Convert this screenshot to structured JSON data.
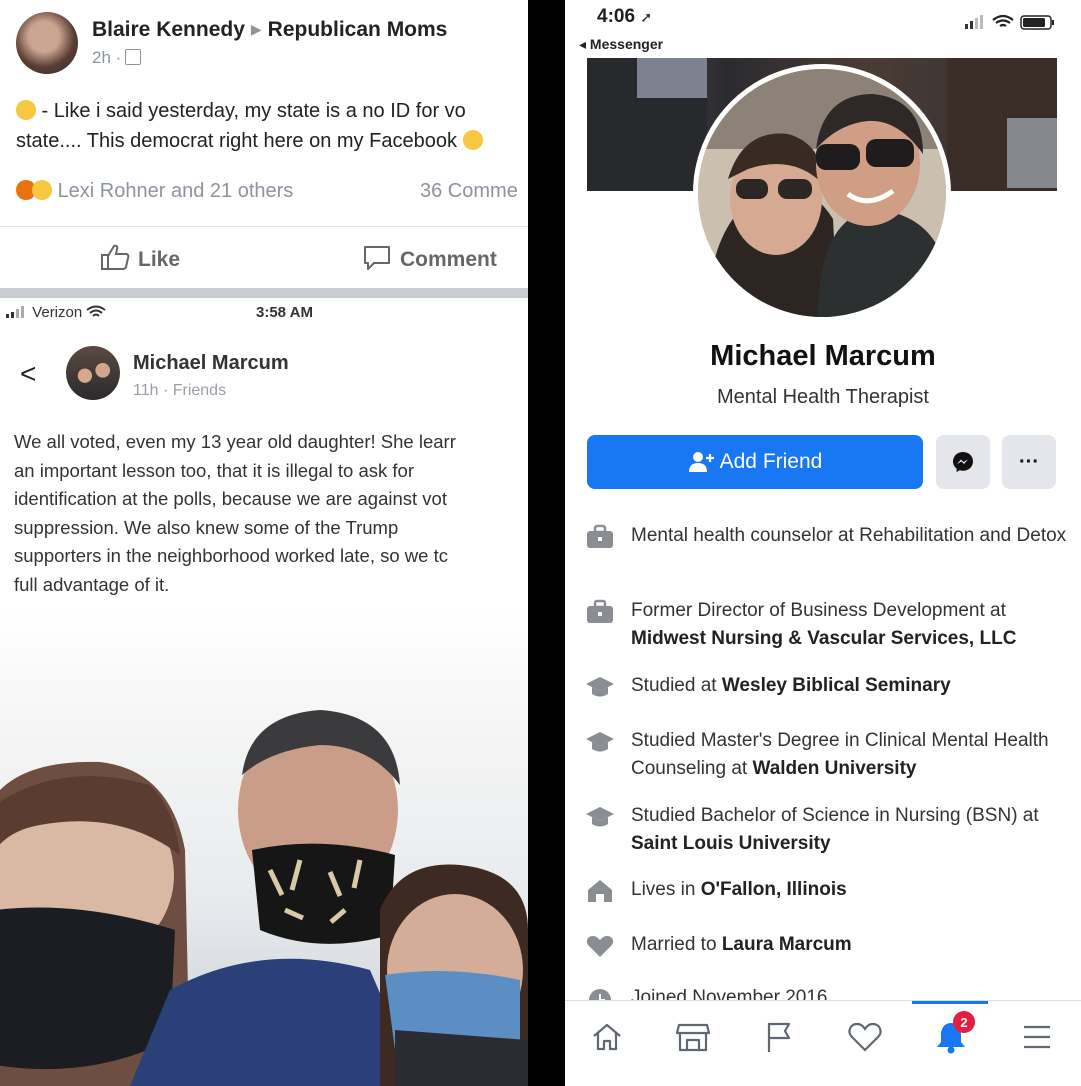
{
  "left_post": {
    "author": "Blaire Kennedy",
    "group": "Republican Moms",
    "time": "2h ·",
    "line1": " - Like i said yesterday, my state is a no ID for vo",
    "line2": "state.... This democrat right here on my Facebook",
    "reactions": "Lexi Rohner and 21 others",
    "comments": "36 Comme",
    "like_label": "Like",
    "comment_label": "Comment"
  },
  "shared_post": {
    "carrier": "Verizon",
    "time_of_day": "3:58 AM",
    "back": "<",
    "author": "Michael Marcum",
    "meta": "11h · Friends",
    "lines": [
      "We all voted, even my 13 year old daughter! She learr",
      "an important lesson too, that it is illegal to ask for",
      "identification at the polls, because we are against vot",
      "suppression. We also knew some of the Trump",
      "supporters in the neighborhood worked late, so we tc",
      "full advantage of it."
    ]
  },
  "profile": {
    "status_time": "4:06",
    "back_label": "◂ Messenger",
    "name": "Michael Marcum",
    "role": "Mental Health Therapist",
    "add_friend": "Add Friend",
    "more": "···",
    "info": [
      {
        "icon": "briefcase",
        "pre": "Mental health counselor at Rehabilitation and Detox",
        "bold": "",
        "post": ""
      },
      {
        "icon": "briefcase",
        "pre": "Former Director of Business Development at ",
        "bold": "Midwest Nursing & Vascular Services, LLC",
        "post": ""
      },
      {
        "icon": "graduation-cap",
        "pre": "Studied at ",
        "bold": "Wesley Biblical Seminary",
        "post": ""
      },
      {
        "icon": "graduation-cap",
        "pre": "Studied Master's Degree in Clinical Mental Health Counseling at ",
        "bold": "Walden University",
        "post": ""
      },
      {
        "icon": "graduation-cap",
        "pre": "Studied Bachelor of Science in Nursing (BSN) at ",
        "bold": "Saint Louis University",
        "post": ""
      },
      {
        "icon": "house",
        "pre": "Lives in ",
        "bold": "O'Fallon, Illinois",
        "post": ""
      },
      {
        "icon": "heart",
        "pre": "Married to ",
        "bold": "Laura Marcum",
        "post": ""
      },
      {
        "icon": "clock",
        "pre": "Joined November 2016",
        "bold": "",
        "post": ""
      }
    ],
    "notifications_count": "2"
  },
  "colors": {
    "facebook_blue": "#1877f2",
    "badge_red": "#e41e3f"
  }
}
